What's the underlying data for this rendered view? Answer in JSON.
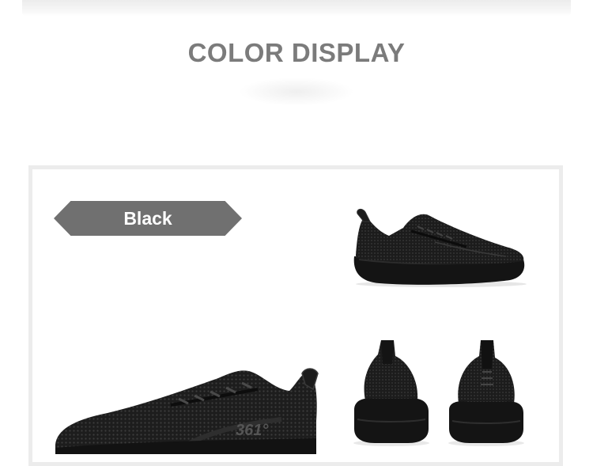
{
  "section": {
    "title": "COLOR DISPLAY"
  },
  "color_badge": {
    "label": "Black"
  },
  "product": {
    "brand_mark": "361°",
    "views": [
      "side-view-right",
      "side-view-left",
      "rear-view",
      "front-view"
    ]
  },
  "colors": {
    "title": "#7b7b7b",
    "badge": "#707070",
    "frame": "#ececec",
    "shoe": "#1b1b1b"
  }
}
